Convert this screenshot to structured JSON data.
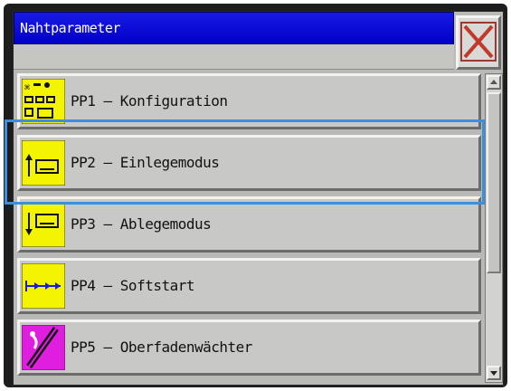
{
  "window": {
    "title": "Nahtparameter"
  },
  "items": [
    {
      "label": "PP1 – Konfiguration",
      "icon": "configuration-icon",
      "icon_color": "#f4f400"
    },
    {
      "label": "PP2 – Einlegemodus",
      "icon": "insert-mode-icon",
      "icon_color": "#f4f400"
    },
    {
      "label": "PP3 – Ablegemodus",
      "icon": "stacking-mode-icon",
      "icon_color": "#f4f400"
    },
    {
      "label": "PP4 – Softstart",
      "icon": "softstart-icon",
      "icon_color": "#f4f400"
    },
    {
      "label": "PP5 – Oberfadenwächter",
      "icon": "upper-thread-monitor-icon",
      "icon_color": "#e01ee0"
    }
  ],
  "selected_index": 1,
  "colors": {
    "title_bar": "#0000c8",
    "close_x": "#c0392b",
    "highlight": "#3a8fe0",
    "icon_yellow": "#f4f400",
    "icon_magenta": "#e01ee0"
  }
}
